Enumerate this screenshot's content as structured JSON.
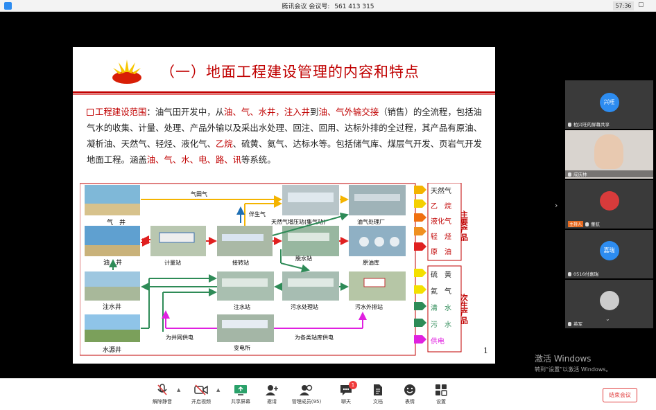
{
  "window": {
    "title": "腾讯会议",
    "meeting_label": "会议号:",
    "meeting_id": "561 413 315",
    "clock": "57:36"
  },
  "slide": {
    "title": "（一）地面工程建设管理的内容和特点",
    "intro": {
      "lead": "工程建设范围",
      "p1": "：油气田开发中，从",
      "r1": "油、气、水井，注入井",
      "p2": "到",
      "r2": "油、气外输交接",
      "p3": "（销售）的全流程，包括油气水的收集、计量、处理、产品外输以及采出水处理、回注、回用、达标外排的全过程，其产品有原油、凝析油、天然气、轻烃、液化气、",
      "r3": "乙烷",
      "p4": "、硫黄、氦气、达标水等。包括储气库、煤层气开发、页岩气开发地面工程。涵盖",
      "r4": "油、气、水、电、路、讯",
      "p5": "等系统。"
    },
    "page_number": "1",
    "diagram": {
      "wells": [
        "气　井",
        "油　井",
        "注水井",
        "水源井"
      ],
      "stations": [
        "计量站",
        "接转站",
        "天然气增压站(集气站)",
        "油气处理厂",
        "脱水站",
        "原油库",
        "注水站",
        "污水处理站",
        "污水外排站",
        "变电所"
      ],
      "flow_labels": [
        "气田气",
        "伴生气",
        "为井网供电",
        "为各类站库供电"
      ],
      "main_products_title": "主要产品",
      "main_products": [
        "天然气",
        "乙　烷",
        "液化气",
        "轻　烃",
        "原　油"
      ],
      "secondary_products_title": "次生产品",
      "secondary_products": [
        "硫　黄",
        "氦　气",
        "清　水",
        "污　水",
        "供电"
      ],
      "colors": {
        "gas": "#f4b400",
        "oil": "#e02020",
        "water": "#2e8b57",
        "power": "#e020e0",
        "liquid_gas": "#f07010",
        "flow_blue": "#1f6fb4"
      }
    }
  },
  "participants": [
    {
      "name": "柏兴旺的屏幕共享",
      "avatar": "兴旺",
      "color": "#2d8cf0",
      "screen": true
    },
    {
      "name": "成庆林",
      "video": true
    },
    {
      "name": "董航",
      "host": true,
      "host_label": "主持人",
      "avatar": "",
      "color": "#d83b3b"
    },
    {
      "name": "0516付嘉瑞",
      "avatar": "嘉瑞",
      "color": "#2d8cf0"
    },
    {
      "name": "英军",
      "avatar": "",
      "color": "#ccc"
    }
  ],
  "watermark": {
    "line1": "激活 Windows",
    "line2": "转到“设置”以激活 Windows。"
  },
  "toolbar": {
    "unmute": "解除静音",
    "video": "开启视频",
    "share": "共享屏幕",
    "invite": "邀请",
    "members": "管理成员(95)",
    "chat": "聊天",
    "chat_badge": "1",
    "docs": "文档",
    "emoji": "表情",
    "settings": "设置",
    "end": "结束会议"
  }
}
